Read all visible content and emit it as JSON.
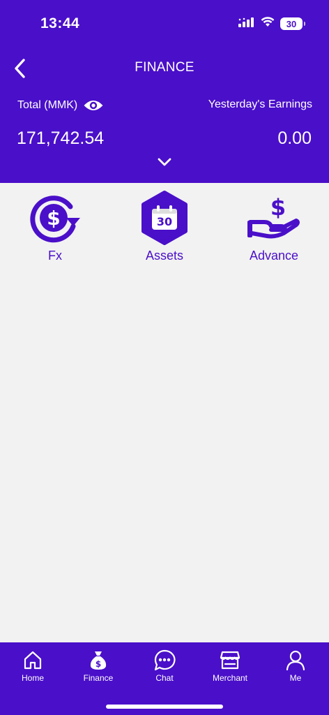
{
  "status_bar": {
    "time": "13:44",
    "battery": "30"
  },
  "header": {
    "title": "FINANCE",
    "total_label": "Total (MMK)",
    "total_value": "171,742.54",
    "earnings_label": "Yesterday's Earnings",
    "earnings_value": "0.00"
  },
  "services": [
    {
      "label": "Fx",
      "icon": "currency-exchange-icon"
    },
    {
      "label": "Assets",
      "icon": "calendar-30-icon",
      "badge": "30"
    },
    {
      "label": "Advance",
      "icon": "hand-dollar-icon"
    }
  ],
  "bottom_nav": [
    {
      "label": "Home",
      "icon": "home-icon"
    },
    {
      "label": "Finance",
      "icon": "money-bag-icon"
    },
    {
      "label": "Chat",
      "icon": "chat-bubble-icon"
    },
    {
      "label": "Merchant",
      "icon": "store-icon"
    },
    {
      "label": "Me",
      "icon": "person-icon"
    }
  ],
  "colors": {
    "brand": "#4a0fc9",
    "background": "#f2f2f2",
    "text_on_brand": "#ffffff"
  }
}
